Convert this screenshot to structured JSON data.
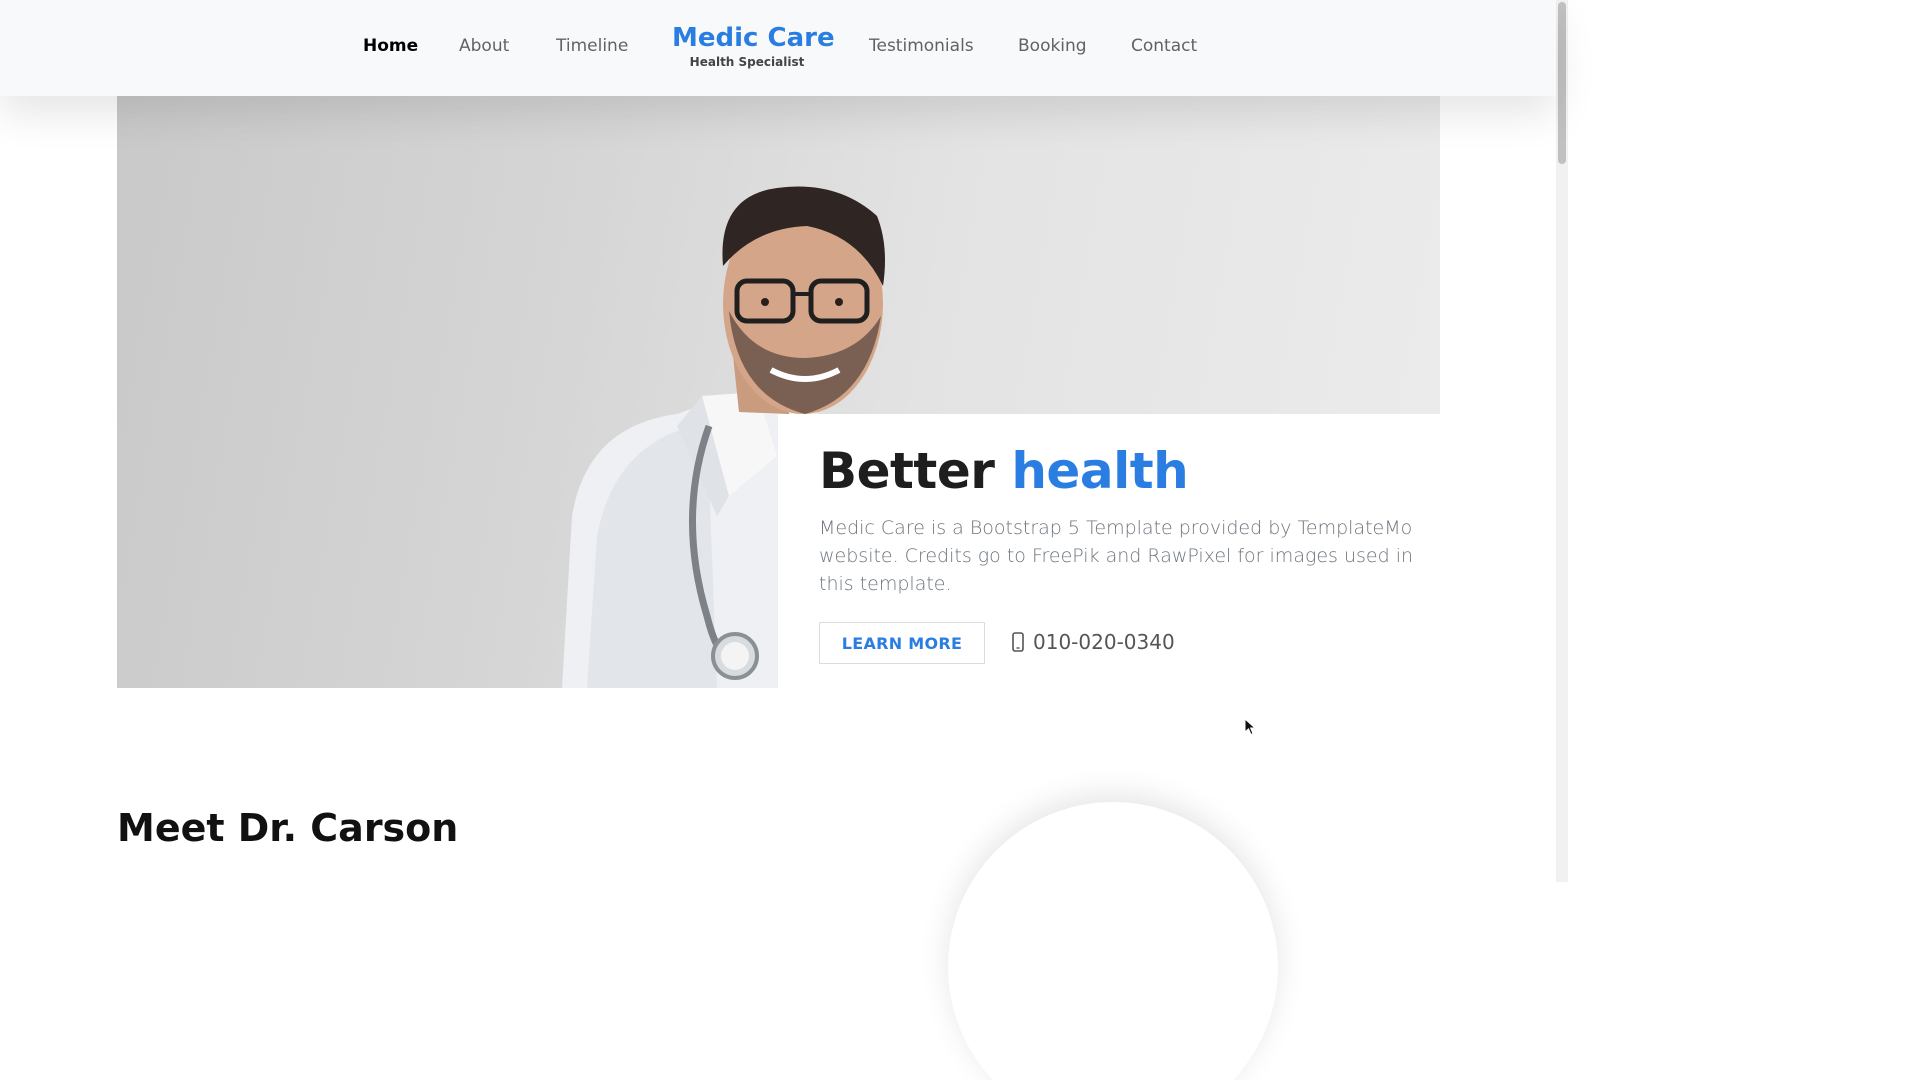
{
  "nav": {
    "items": [
      {
        "label": "Home",
        "active": true
      },
      {
        "label": "About"
      },
      {
        "label": "Timeline"
      },
      {
        "label": "Testimonials"
      },
      {
        "label": "Booking"
      },
      {
        "label": "Contact"
      }
    ],
    "brand_title": "Medic Care",
    "brand_subtitle": "Health Specialist"
  },
  "hero": {
    "title_main": "Better",
    "title_accent": "health",
    "description": "Medic Care is a Bootstrap 5 Template provided by TemplateMo website. Credits go to FreePik and RawPixel for images used in this template.",
    "button_label": "LEARN MORE",
    "phone": "010-020-0340",
    "phone_icon": "mobile-phone-icon"
  },
  "about": {
    "title": "Meet Dr. Carson"
  },
  "colors": {
    "accent": "#2a7de1",
    "navbar_bg": "#f8f9fa",
    "text_muted": "#6c757d"
  }
}
